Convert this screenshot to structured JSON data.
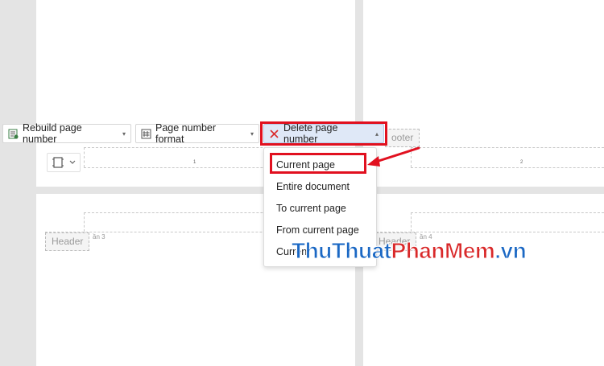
{
  "toolbar": {
    "rebuild_label": "Rebuild page number",
    "format_label": "Page number format",
    "delete_label": "Delete page number"
  },
  "menu": {
    "items": [
      "Current page",
      "Entire document",
      "To current page",
      "From current page",
      "Curren"
    ]
  },
  "pages": {
    "footer_tag": "ooter",
    "header_tag_left": "Header",
    "header_tag_right": "Header",
    "section_left": "ần 3",
    "section_right": "ần 4",
    "page_num_1": "1",
    "page_num_2": "2"
  },
  "watermark": {
    "part1": "ThuThuat",
    "part2": "PhanMem",
    "part3": ".vn"
  },
  "colors": {
    "highlight": "#e1101f",
    "watermark_blue": "#1b68c4",
    "watermark_red": "#d9292a",
    "watermark_orange": "#f28c28"
  }
}
